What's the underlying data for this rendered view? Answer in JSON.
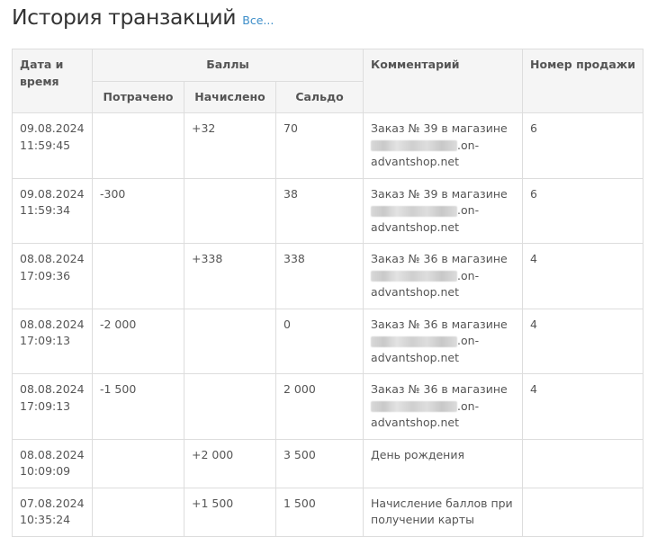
{
  "header": {
    "title": "История транзакций",
    "all_link": "Все..."
  },
  "table": {
    "headers": {
      "datetime": "Дата и время",
      "points": "Баллы",
      "spent": "Потрачено",
      "accrued": "Начислено",
      "balance": "Сальдо",
      "comment": "Комментарий",
      "sale_number": "Номер продажи"
    },
    "rows": [
      {
        "date": "09.08.2024",
        "time": "11:59:45",
        "spent": "",
        "accrued": "+32",
        "balance": "70",
        "comment_prefix": "Заказ № 39 в магазине",
        "comment_suffix": ".on-advantshop.net",
        "comment_blurred": true,
        "sale": "6"
      },
      {
        "date": "09.08.2024",
        "time": "11:59:34",
        "spent": "-300",
        "accrued": "",
        "balance": "38",
        "comment_prefix": "Заказ № 39 в магазине",
        "comment_suffix": ".on-advantshop.net",
        "comment_blurred": true,
        "sale": "6"
      },
      {
        "date": "08.08.2024",
        "time": "17:09:36",
        "spent": "",
        "accrued": "+338",
        "balance": "338",
        "comment_prefix": "Заказ № 36 в магазине",
        "comment_suffix": ".on-advantshop.net",
        "comment_blurred": true,
        "sale": "4"
      },
      {
        "date": "08.08.2024",
        "time": "17:09:13",
        "spent": "-2 000",
        "accrued": "",
        "balance": "0",
        "comment_prefix": "Заказ № 36 в магазине",
        "comment_suffix": ".on-advantshop.net",
        "comment_blurred": true,
        "sale": "4"
      },
      {
        "date": "08.08.2024",
        "time": "17:09:13",
        "spent": "-1 500",
        "accrued": "",
        "balance": "2 000",
        "comment_prefix": "Заказ № 36 в магазине",
        "comment_suffix": ".on-advantshop.net",
        "comment_blurred": true,
        "sale": "4"
      },
      {
        "date": "08.08.2024",
        "time": "10:09:09",
        "spent": "",
        "accrued": "+2 000",
        "balance": "3 500",
        "comment_prefix": "День рождения",
        "comment_suffix": "",
        "comment_blurred": false,
        "sale": ""
      },
      {
        "date": "07.08.2024",
        "time": "10:35:24",
        "spent": "",
        "accrued": "+1 500",
        "balance": "1 500",
        "comment_prefix": "Начисление баллов при получении карты",
        "comment_suffix": "",
        "comment_blurred": false,
        "sale": ""
      }
    ]
  },
  "colors": {
    "link": "#3d8ec9",
    "header_bg": "#f5f5f5",
    "border": "#dddddd",
    "text": "#555555"
  }
}
